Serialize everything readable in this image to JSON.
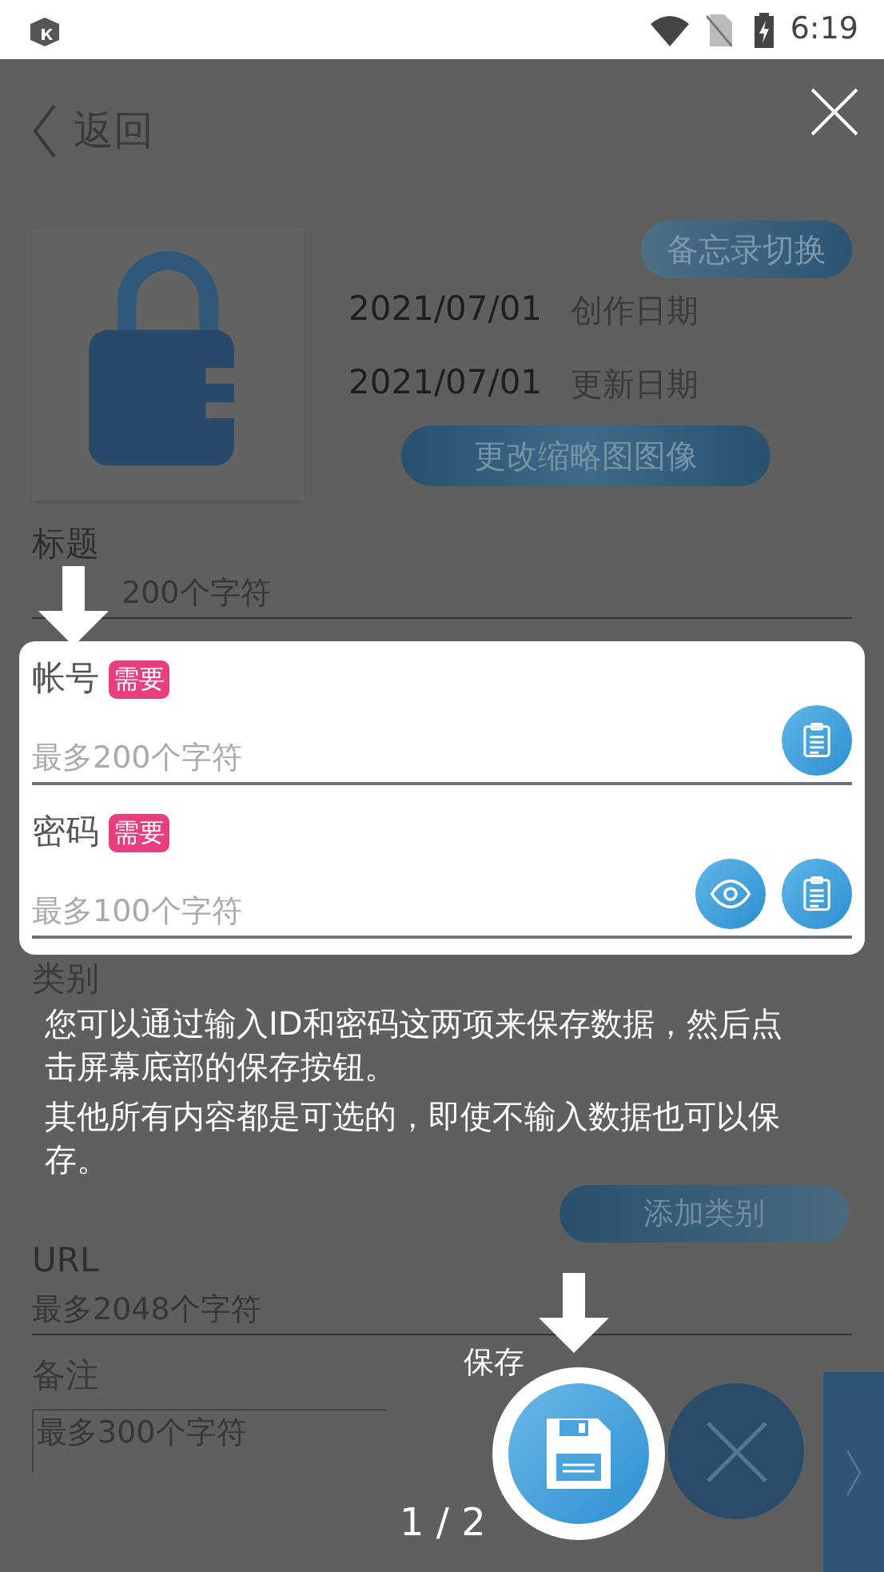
{
  "status_bar": {
    "time": "6:19"
  },
  "header": {
    "back_label": "返回"
  },
  "record": {
    "memo_toggle": "备忘录切换",
    "dates": [
      {
        "date": "2021/07/01",
        "label": "创作日期"
      },
      {
        "date": "2021/07/01",
        "label": "更新日期"
      }
    ],
    "change_thumbnail": "更改缩略图图像"
  },
  "title_field": {
    "label": "标题",
    "placeholder": "200个字符"
  },
  "required_fields": [
    {
      "label": "帐号",
      "badge": "需要",
      "placeholder": "最多200个字符",
      "actions": [
        {
          "kind": "paste"
        }
      ]
    },
    {
      "label": "密码",
      "badge": "需要",
      "placeholder": "最多100个字符",
      "actions": [
        {
          "kind": "show"
        },
        {
          "kind": "paste"
        }
      ]
    }
  ],
  "category": {
    "label": "类别",
    "add_button": "添加类别"
  },
  "url_field": {
    "label": "URL",
    "placeholder": "最多2048个字符"
  },
  "note_field": {
    "label": "备注",
    "placeholder": "最多300个字符"
  },
  "tutorial": {
    "paragraphs": [
      "您可以通过输入ID和密码这两项来保存数据，然后点击屏幕底部的保存按钮。",
      "其他所有内容都是可选的，即使不输入数据也可以保存。"
    ],
    "save_label": "保存",
    "page": "1 / 2"
  }
}
